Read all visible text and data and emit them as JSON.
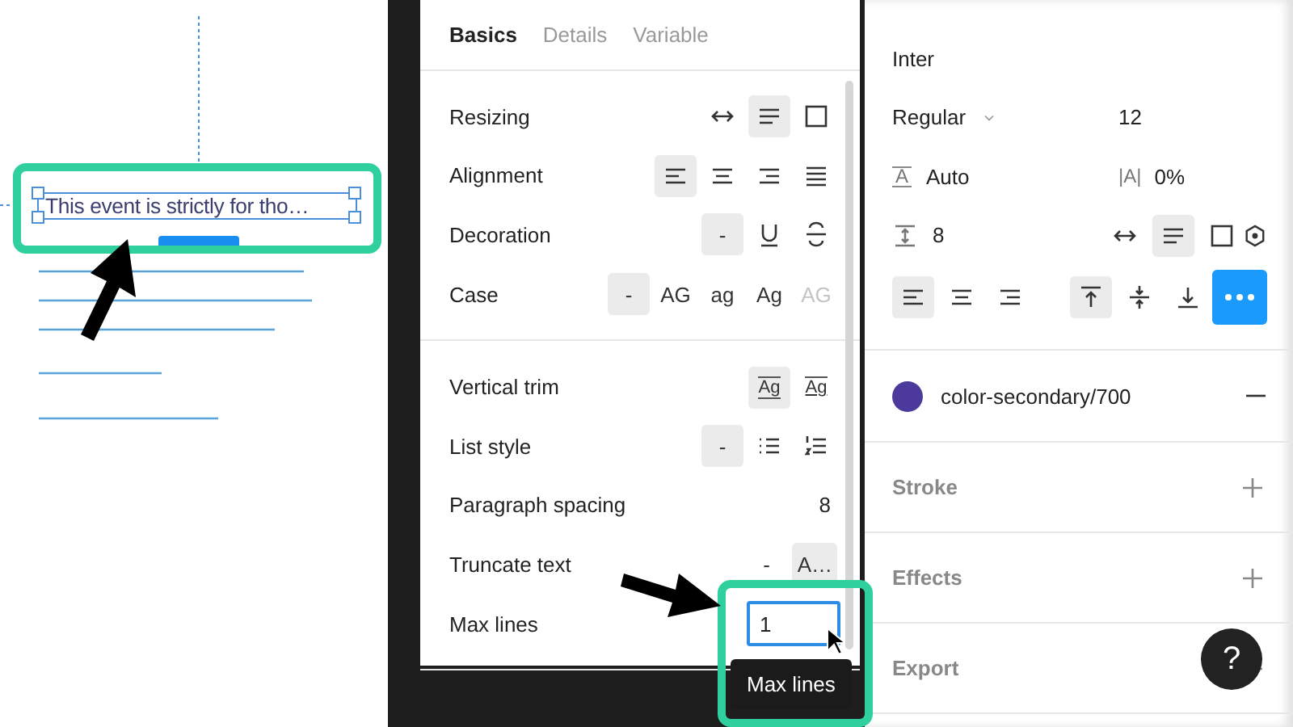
{
  "canvas": {
    "text_layer": "This event is strictly for tho…"
  },
  "popup": {
    "tabs": [
      {
        "label": "Basics",
        "selected": true
      },
      {
        "label": "Details",
        "selected": false
      },
      {
        "label": "Variable",
        "selected": false
      }
    ],
    "sections": [
      {
        "rows": [
          {
            "label": "Resizing",
            "kind": "options",
            "options": [
              {
                "selected": false
              },
              {
                "selected": true
              },
              {
                "selected": false
              }
            ]
          },
          {
            "label": "Alignment",
            "kind": "options",
            "options": [
              {
                "selected": true
              },
              {
                "selected": false
              },
              {
                "selected": false
              },
              {
                "selected": false
              }
            ]
          },
          {
            "label": "Decoration",
            "kind": "options",
            "options": [
              {
                "text": "-",
                "selected": true
              },
              {
                "selected": false
              },
              {
                "selected": false
              }
            ]
          },
          {
            "label": "Case",
            "kind": "options",
            "options": [
              {
                "text": "-",
                "selected": true,
                "disabled": false
              },
              {
                "text": "AG",
                "selected": false,
                "disabled": false
              },
              {
                "text": "ag",
                "selected": false,
                "disabled": false
              },
              {
                "text": "Ag",
                "selected": false,
                "disabled": false
              },
              {
                "text": "AG",
                "selected": false,
                "disabled": true
              }
            ]
          }
        ]
      },
      {
        "rows": [
          {
            "label": "Vertical trim",
            "kind": "options",
            "options": [
              {
                "text": "Ag",
                "selected": true
              },
              {
                "text": "Ag",
                "selected": false
              }
            ]
          },
          {
            "label": "List style",
            "kind": "options",
            "options": [
              {
                "text": "-",
                "selected": true
              },
              {
                "selected": false
              },
              {
                "selected": false
              }
            ]
          },
          {
            "label": "Paragraph spacing",
            "kind": "value",
            "value": "8"
          },
          {
            "label": "Truncate text",
            "kind": "options",
            "options": [
              {
                "text": "-",
                "selected": false
              },
              {
                "text": "A…",
                "selected": true
              }
            ]
          },
          {
            "label": "Max lines",
            "kind": "field",
            "value": "1",
            "tooltip": "Max lines"
          }
        ]
      }
    ]
  },
  "typography": {
    "font": "Inter",
    "style": "Regular",
    "size": "12",
    "line_height": {
      "symbol": "A",
      "value": "Auto"
    },
    "letter_spacing": {
      "symbol": "|A|",
      "value": "0%"
    },
    "paragraph_spacing": "8",
    "resizing": [
      {
        "selected": false
      },
      {
        "selected": true
      },
      {
        "selected": false
      }
    ],
    "align": [
      {
        "selected": true
      },
      {
        "selected": false
      },
      {
        "selected": false
      }
    ],
    "vertical_align": [
      {
        "selected": true
      },
      {
        "selected": false
      },
      {
        "selected": false
      }
    ],
    "more": {
      "selected": true
    }
  },
  "fill": {
    "name": "color-secondary/700",
    "color": "#4b3a9c"
  },
  "sections": [
    {
      "title": "Stroke"
    },
    {
      "title": "Effects"
    },
    {
      "title": "Export"
    }
  ],
  "help": "?"
}
